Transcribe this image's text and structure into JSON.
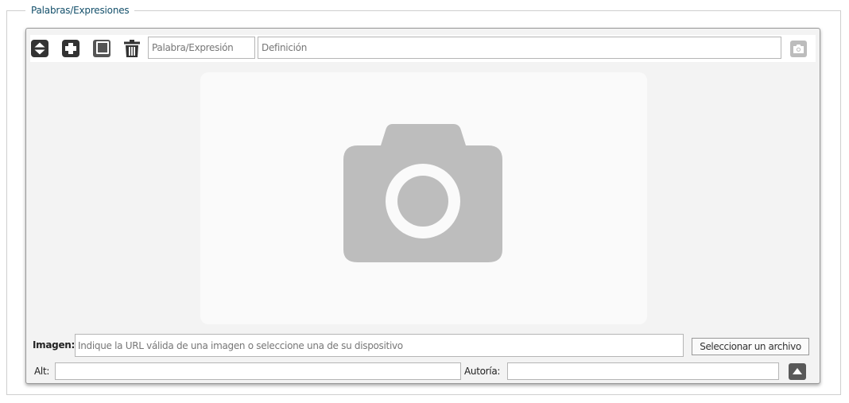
{
  "section": {
    "legend": "Palabras/Expresiones"
  },
  "toolbar": {
    "icons": [
      "expand-collapse-icon",
      "add-icon",
      "duplicate-icon",
      "trash-icon",
      "camera-icon"
    ],
    "word_placeholder": "Palabra/Expresión",
    "definition_placeholder": "Definición"
  },
  "image": {
    "label": "Imagen:",
    "url_placeholder": "Indique la URL válida de una imagen o seleccione una de su dispositivo",
    "select_file_label": "Seleccionar un archivo",
    "alt_label": "Alt:",
    "alt_value": "",
    "author_label": "Autoría:",
    "author_value": "",
    "collapse_icon": "caret-up-icon"
  },
  "colors": {
    "legend": "#14506b",
    "icon_dark": "#333333",
    "placeholder_camera": "#bdbdbd",
    "collapse_button": "#595959"
  }
}
